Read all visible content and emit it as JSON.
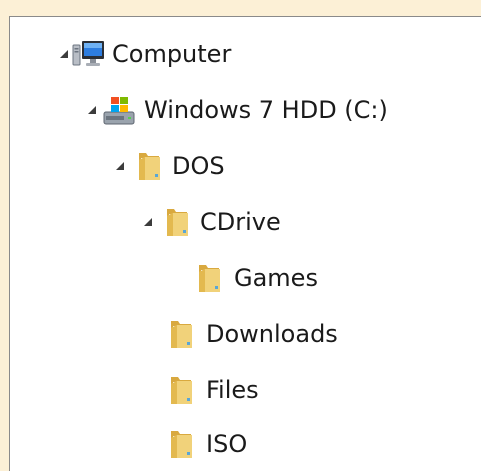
{
  "tree": {
    "items": [
      {
        "label": "Computer",
        "icon": "computer-icon",
        "expanded": true,
        "level": 0
      },
      {
        "label": "Windows 7 HDD (C:)",
        "icon": "windows-drive-icon",
        "expanded": true,
        "level": 1
      },
      {
        "label": "DOS",
        "icon": "folder-icon",
        "expanded": true,
        "level": 2
      },
      {
        "label": "CDrive",
        "icon": "folder-icon",
        "expanded": true,
        "level": 3
      },
      {
        "label": "Games",
        "icon": "folder-icon",
        "expanded": null,
        "level": 4
      },
      {
        "label": "Downloads",
        "icon": "folder-icon",
        "expanded": null,
        "level": 3
      },
      {
        "label": "Files",
        "icon": "folder-icon",
        "expanded": null,
        "level": 3
      },
      {
        "label": "ISO",
        "icon": "folder-icon",
        "expanded": null,
        "level": 3
      }
    ]
  },
  "colors": {
    "background": "#fcf0d6",
    "pane": "#ffffff",
    "text": "#1a1a1a",
    "folder": "#e9c86a"
  }
}
